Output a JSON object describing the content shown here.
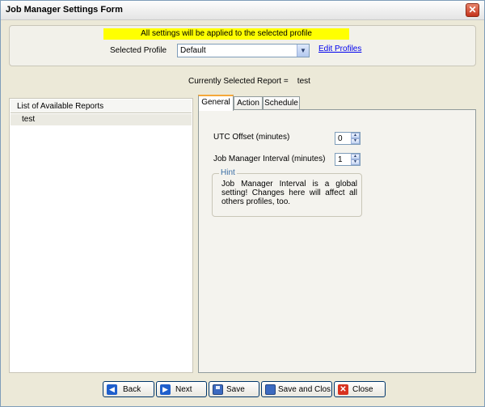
{
  "window": {
    "title": "Job Manager Settings Form",
    "close_glyph": "✕"
  },
  "profile": {
    "banner": "All settings will be applied to the selected profile",
    "label": "Selected Profile",
    "selected": "Default",
    "edit_link": "Edit Profiles"
  },
  "current_report": {
    "label": "Currently Selected Report =",
    "value": "test"
  },
  "reports_list": {
    "header": "List of Available Reports",
    "items": [
      "test"
    ]
  },
  "tabs": [
    {
      "label": "General",
      "active": true
    },
    {
      "label": "Action",
      "active": false
    },
    {
      "label": "Schedule",
      "active": false
    }
  ],
  "general": {
    "utc_offset_label": "UTC Offset (minutes)",
    "utc_offset_value": "0",
    "interval_label": "Job Manager Interval (minutes)",
    "interval_value": "1",
    "hint_title": "Hint",
    "hint_text": "Job Manager Interval is a global setting! Changes here will affect all others profiles, too."
  },
  "buttons": {
    "back": "Back",
    "next": "Next",
    "save": "Save",
    "save_close": "Save and Clos",
    "close": "Close"
  },
  "icons": {
    "back": "arrow-left-icon",
    "next": "arrow-right-icon",
    "save": "floppy-disk-icon",
    "save_close": "save-and-close-icon",
    "close": "close-icon"
  },
  "colors": {
    "banner": "#ffff00",
    "link": "#0000ee",
    "active_tab_accent": "#f5a83a",
    "hint_title": "#3a6ea5"
  }
}
